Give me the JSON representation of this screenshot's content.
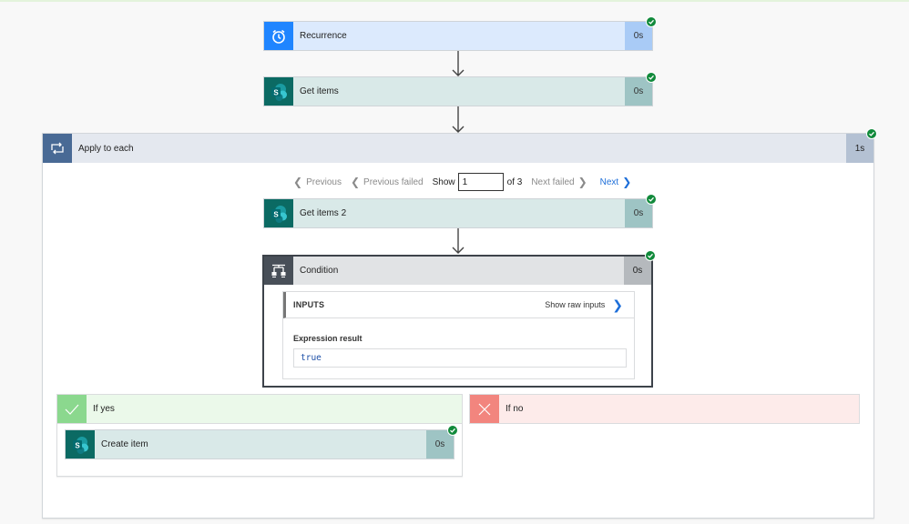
{
  "flow": {
    "steps": {
      "recurrence": {
        "title": "Recurrence",
        "duration": "0s",
        "status": "succeeded",
        "icon": "alarm-clock-icon"
      },
      "get_items": {
        "title": "Get items",
        "duration": "0s",
        "status": "succeeded",
        "icon": "sharepoint-icon"
      }
    },
    "apply_to_each": {
      "title": "Apply to each",
      "duration": "1s",
      "status": "succeeded",
      "icon": "loop-icon",
      "pager": {
        "previous": "Previous",
        "previous_failed": "Previous failed",
        "show_label": "Show",
        "current_value": "1",
        "of_label": "of 3",
        "next_failed": "Next failed",
        "next": "Next"
      },
      "get_items_2": {
        "title": "Get items 2",
        "duration": "0s",
        "status": "succeeded",
        "icon": "sharepoint-icon"
      },
      "condition": {
        "title": "Condition",
        "duration": "0s",
        "status": "succeeded",
        "icon": "condition-icon",
        "inputs_label": "INPUTS",
        "show_raw_inputs": "Show raw inputs",
        "expression_label": "Expression result",
        "expression_value": "true"
      },
      "if_yes": {
        "title": "If yes",
        "icon": "checkmark-icon",
        "create_item": {
          "title": "Create item",
          "duration": "0s",
          "status": "succeeded",
          "icon": "sharepoint-icon"
        }
      },
      "if_no": {
        "title": "If no",
        "icon": "x-icon"
      }
    }
  },
  "colors": {
    "success": "#118a3b",
    "recurrence": "#1f85ff",
    "sharepoint": "#0b6a63",
    "loop": "#496a95",
    "condition": "#484f58",
    "yes": "#8bd88e",
    "no": "#f2857e",
    "link": "#1e6fd9"
  }
}
